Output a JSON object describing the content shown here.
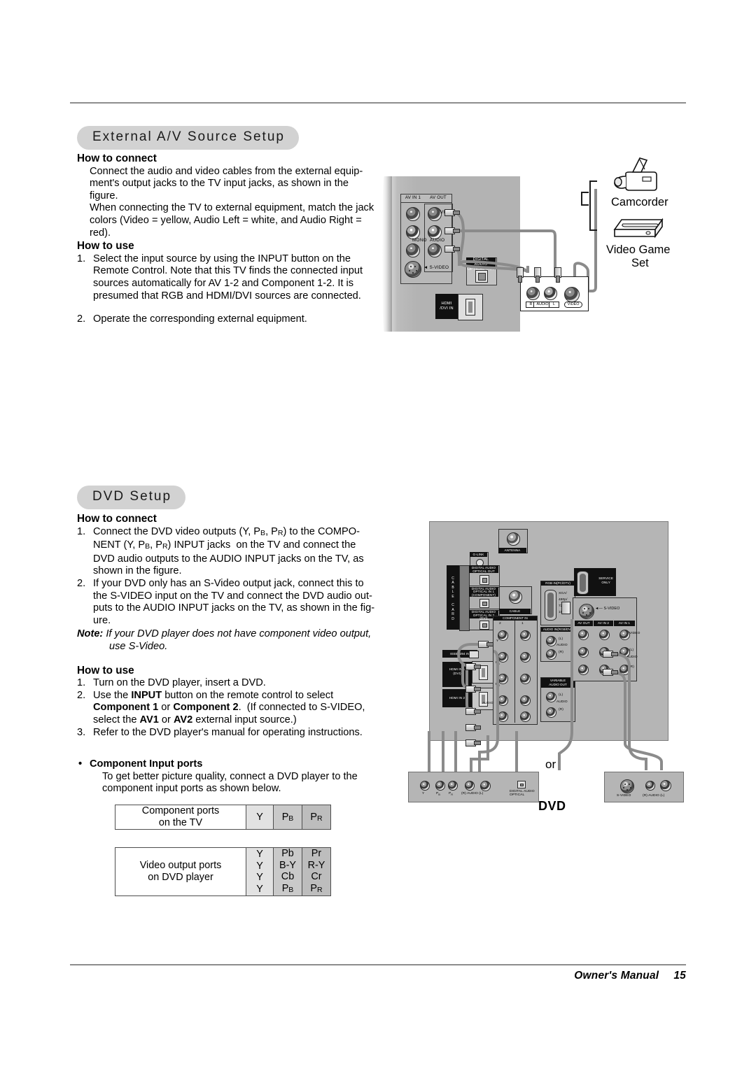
{
  "page": {
    "footer_text": "Owner's Manual",
    "page_number": "15"
  },
  "sections": {
    "av": {
      "pill_title": "External A/V Source Setup",
      "how_to_connect_heading": "How to connect",
      "connect_paragraphs": [
        "Connect the audio and video cables from the external equip-ment's output jacks to the TV input jacks, as shown in the figure.",
        "When connecting the TV to external equipment, match the jack colors (Video = yellow, Audio Left = white, and Audio Right = red)."
      ],
      "how_to_use_heading": "How to use",
      "use_steps": [
        {
          "num": "1.",
          "text": "Select the input source by using the INPUT button on the Remote Control. Note that this TV finds the connected input sources automatically for AV 1-2 and Component 1-2. It is presumed that RGB and HDMI/DVI sources are connected."
        },
        {
          "num": "2.",
          "text": "Operate the corresponding external equipment."
        }
      ]
    },
    "dvd": {
      "pill_title": "DVD Setup",
      "how_to_connect_heading": "How to connect",
      "connect_steps": [
        {
          "num": "1.",
          "text": "Connect the DVD video outputs (Y, PB, PR) to the COMPO-NENT (Y, PB, PR) INPUT jacks  on the TV and connect the DVD audio outputs to the AUDIO INPUT jacks on the TV, as shown in the figure."
        },
        {
          "num": "2.",
          "text": "If your DVD only has an S-Video output jack, connect this to the S-VIDEO input on the TV and connect the DVD audio out-puts to the AUDIO INPUT jacks on the TV, as shown in the fig-ure."
        }
      ],
      "note_label": "Note:",
      "note_text": "If your DVD player does not have component video output,",
      "note_text2": "use S-Video.",
      "how_to_use_heading": "How to use",
      "use_steps": [
        {
          "num": "1.",
          "text": "Turn on the DVD player, insert a DVD."
        },
        {
          "num": "2.",
          "text": "Use the INPUT button on the remote control to select Component 1 or Component 2.  (If connected to S-VIDEO, select the AV1 or AV2 external input source.)"
        },
        {
          "num": "3.",
          "text": "Refer to the DVD player's manual for operating instructions."
        }
      ],
      "bullet_title": "Component Input ports",
      "bullet_body": "To get better picture quality, connect a DVD player to the component input ports as shown below."
    }
  },
  "ports_tables": [
    {
      "label_line1": "Component ports",
      "label_line2": "on the TV",
      "columns": [
        [
          "Y"
        ],
        [
          "PB"
        ],
        [
          "PR"
        ]
      ]
    },
    {
      "label_line1": "Video output ports",
      "label_line2": "on DVD player",
      "columns": [
        [
          "Y",
          "Y",
          "Y",
          "Y"
        ],
        [
          "Pb",
          "B-Y",
          "Cb",
          "PB"
        ],
        [
          "Pr",
          "R-Y",
          "Cr",
          "PR"
        ]
      ]
    }
  ],
  "diagram_av": {
    "panel_labels": {
      "av_in_1": "AV IN 1",
      "av_out": "AV OUT",
      "video": "VIDEO",
      "mono": "MONO",
      "audio": "AUDIO",
      "s_video": "S-VIDEO",
      "digital_audio_optical_out": "DIGITAL AUDIO\nOPTICAL OUT",
      "hdmi_dvi_in": "HDMI\n/DVI IN"
    },
    "external_device": {
      "r": "R",
      "audio": "AUDIO",
      "l": "L",
      "video": "VIDEO"
    },
    "devices": [
      {
        "name": "Camcorder"
      },
      {
        "name": "Video Game",
        "name2": "Set"
      }
    ]
  },
  "diagram_dvd": {
    "panel_labels": {
      "antenna": "ANTENNA",
      "g_link": "G-LINK",
      "cable": "CABLE",
      "cable_card": "CABLE CARD",
      "digital_audio_optical_out": "DIGITAL AUDIO\nOPTICAL OUT",
      "digital_audio_optical_in_component": "DIGITAL AUDIO\nOPTICAL IN 1\n(COMPONENT)",
      "digital_audio_optical_in_dvi": "DIGITAL AUDIO\nOPTICAL IN 2\n(DVI)",
      "ieee1394": "IEEE1394 IN",
      "hdmi_in_1": "HDMI IN 1\n(DVI)",
      "hdmi_in_2": "HDMI IN 2",
      "component_in": "COMPONENT IN",
      "component_col_2": "2",
      "component_col_1": "1",
      "y": "Y",
      "pb": "PB",
      "pr": "PR",
      "audio": "AUDIO",
      "rgb_in": "RGB IN(PC/DTV)",
      "rgb_modes": "XGA/\n480p/\n720p/\n1080i",
      "audio_in_rgb_dvi": "AUDIO IN(RGB/DVI)",
      "variable_audio_out": "VARIABLE\nAUDIO OUT",
      "left": "(L)",
      "right": "(R)",
      "audio_vert": "AUDIO",
      "service_only": "SERVICE\nONLY",
      "s_video": "S-VIDEO",
      "av_in_2": "AV IN 2",
      "av_in_1": "AV IN 1",
      "av_out": "AV OUT",
      "video": "VIDEO"
    },
    "dvd_device": {
      "y": "Y",
      "pb": "PB",
      "pr": "PR",
      "audio": "(R) AUDIO (L)",
      "digital_audio_optical": "DIGITAL AUDIO\nOPTICAL",
      "s_video": "S-VIDEO",
      "audio2": "(R) AUDIO (L)"
    },
    "or_label": "or",
    "dvd_label": "DVD"
  },
  "colors": {
    "pill_bg": "#d2d2d2",
    "rule": "#8d8d8d",
    "panel_grey": "#b3b3b3",
    "col_y": "#e2e2e2",
    "col_pb": "#c9c9c9",
    "col_pr": "#bdbdbd"
  }
}
